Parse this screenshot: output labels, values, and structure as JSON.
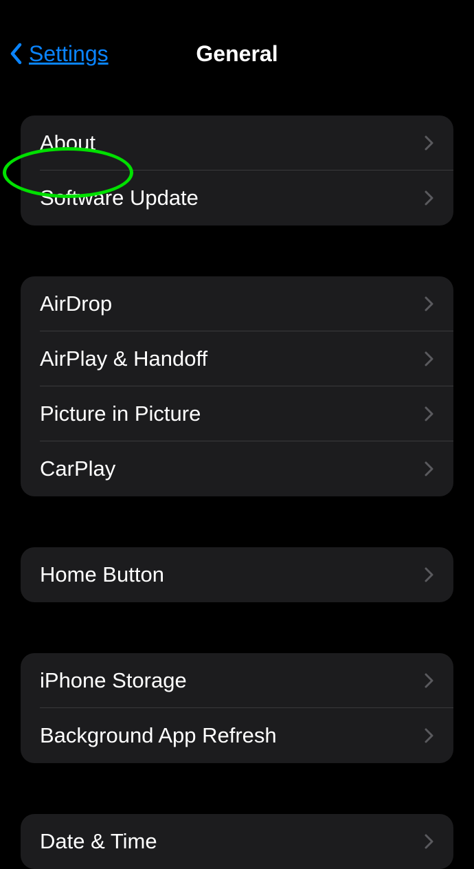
{
  "header": {
    "back_label": "Settings",
    "title": "General"
  },
  "groups": [
    {
      "id": "about-group",
      "items": [
        {
          "id": "about",
          "label": "About"
        },
        {
          "id": "software-update",
          "label": "Software Update"
        }
      ]
    },
    {
      "id": "connectivity-group",
      "items": [
        {
          "id": "airdrop",
          "label": "AirDrop"
        },
        {
          "id": "airplay-handoff",
          "label": "AirPlay & Handoff"
        },
        {
          "id": "picture-in-picture",
          "label": "Picture in Picture"
        },
        {
          "id": "carplay",
          "label": "CarPlay"
        }
      ]
    },
    {
      "id": "home-button-group",
      "items": [
        {
          "id": "home-button",
          "label": "Home Button"
        }
      ]
    },
    {
      "id": "storage-group",
      "items": [
        {
          "id": "iphone-storage",
          "label": "iPhone Storage"
        },
        {
          "id": "background-app-refresh",
          "label": "Background App Refresh"
        }
      ]
    },
    {
      "id": "datetime-group",
      "items": [
        {
          "id": "date-time",
          "label": "Date & Time"
        }
      ]
    }
  ],
  "highlight": {
    "target": "about"
  }
}
